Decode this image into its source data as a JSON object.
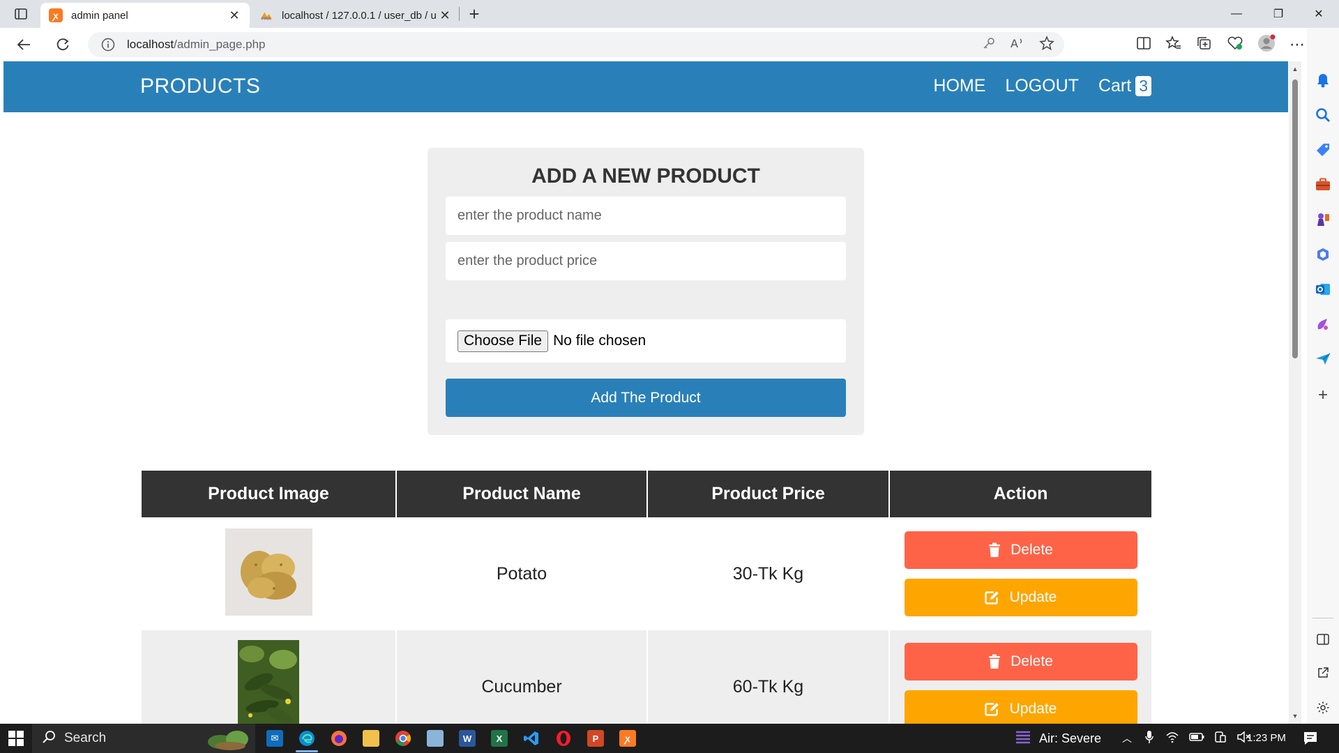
{
  "browser": {
    "tabs": [
      {
        "title": "admin panel",
        "active": true
      },
      {
        "title": "localhost / 127.0.0.1 / user_db / u",
        "active": false
      }
    ],
    "url_host": "localhost",
    "url_path": "/admin_page.php"
  },
  "nav": {
    "brand": "PRODUCTS",
    "home": "HOME",
    "logout": "LOGOUT",
    "cart_label": "Cart",
    "cart_count": "3"
  },
  "form": {
    "title": "ADD A NEW PRODUCT",
    "name_placeholder": "enter the product name",
    "price_placeholder": "enter the product price",
    "choose_file": "Choose File",
    "file_status": "No file chosen",
    "submit": "Add The Product"
  },
  "table": {
    "headers": [
      "Product Image",
      "Product Name",
      "Product Price",
      "Action"
    ],
    "rows": [
      {
        "name": "Potato",
        "price": "30-Tk Kg",
        "delete": "Delete",
        "update": "Update"
      },
      {
        "name": "Cucumber",
        "price": "60-Tk Kg",
        "delete": "Delete",
        "update": "Update"
      }
    ]
  },
  "taskbar": {
    "search": "Search",
    "weather": "Air: Severe",
    "time": "1:23 PM"
  },
  "colors": {
    "navbar": "#2980b9",
    "delete": "#ff6347",
    "update": "#ffa500",
    "table_header": "#333333"
  },
  "icons": [
    "trash-icon",
    "edit-icon",
    "back-icon",
    "reload-icon",
    "info-icon",
    "star-icon",
    "search-icon",
    "windows-icon"
  ]
}
